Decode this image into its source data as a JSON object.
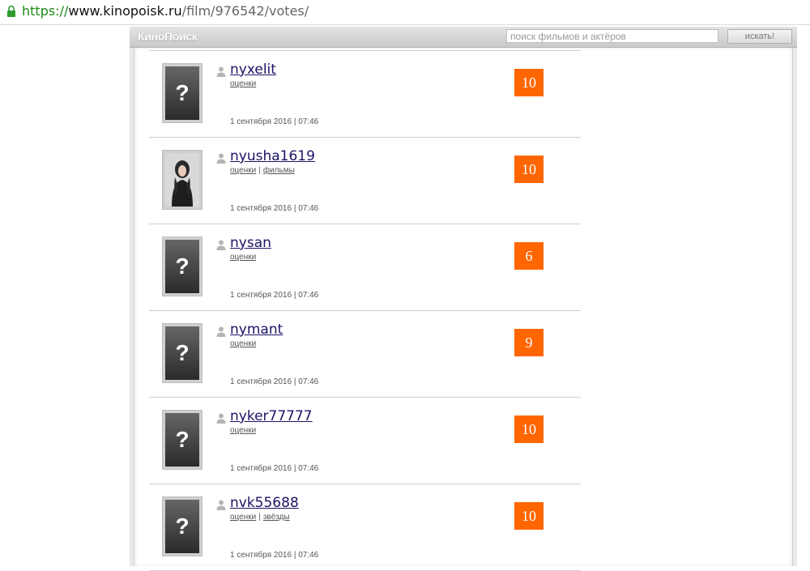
{
  "browser": {
    "url_scheme": "https://",
    "url_host": "www.kinopoisk.ru",
    "url_path": "/film/976542/votes/"
  },
  "header": {
    "logo": "КиноПоиск",
    "search_placeholder": "поиск фильмов и актёров",
    "search_button": "искать!"
  },
  "colors": {
    "score_bg": "#ff6600",
    "username": "#1b1464",
    "secure_scheme": "#1a8a1a"
  },
  "votes": [
    {
      "username": "nyxelit",
      "links": [
        "оценки"
      ],
      "date": "1 сентября 2016 | 07:46",
      "score": "10",
      "avatar": "placeholder"
    },
    {
      "username": "nyusha1619",
      "links": [
        "оценки",
        "фильмы"
      ],
      "date": "1 сентября 2016 | 07:46",
      "score": "10",
      "avatar": "photo"
    },
    {
      "username": "nysan",
      "links": [
        "оценки"
      ],
      "date": "1 сентября 2016 | 07:46",
      "score": "6",
      "avatar": "placeholder"
    },
    {
      "username": "nymant",
      "links": [
        "оценки"
      ],
      "date": "1 сентября 2016 | 07:46",
      "score": "9",
      "avatar": "placeholder"
    },
    {
      "username": "nyker77777",
      "links": [
        "оценки"
      ],
      "date": "1 сентября 2016 | 07:46",
      "score": "10",
      "avatar": "placeholder"
    },
    {
      "username": "nvk55688",
      "links": [
        "оценки",
        "звёзды"
      ],
      "date": "1 сентября 2016 | 07:46",
      "score": "10",
      "avatar": "placeholder"
    }
  ],
  "avatar_placeholder_glyph": "?",
  "icons": {
    "lock": "lock-icon",
    "user": "user-icon"
  }
}
